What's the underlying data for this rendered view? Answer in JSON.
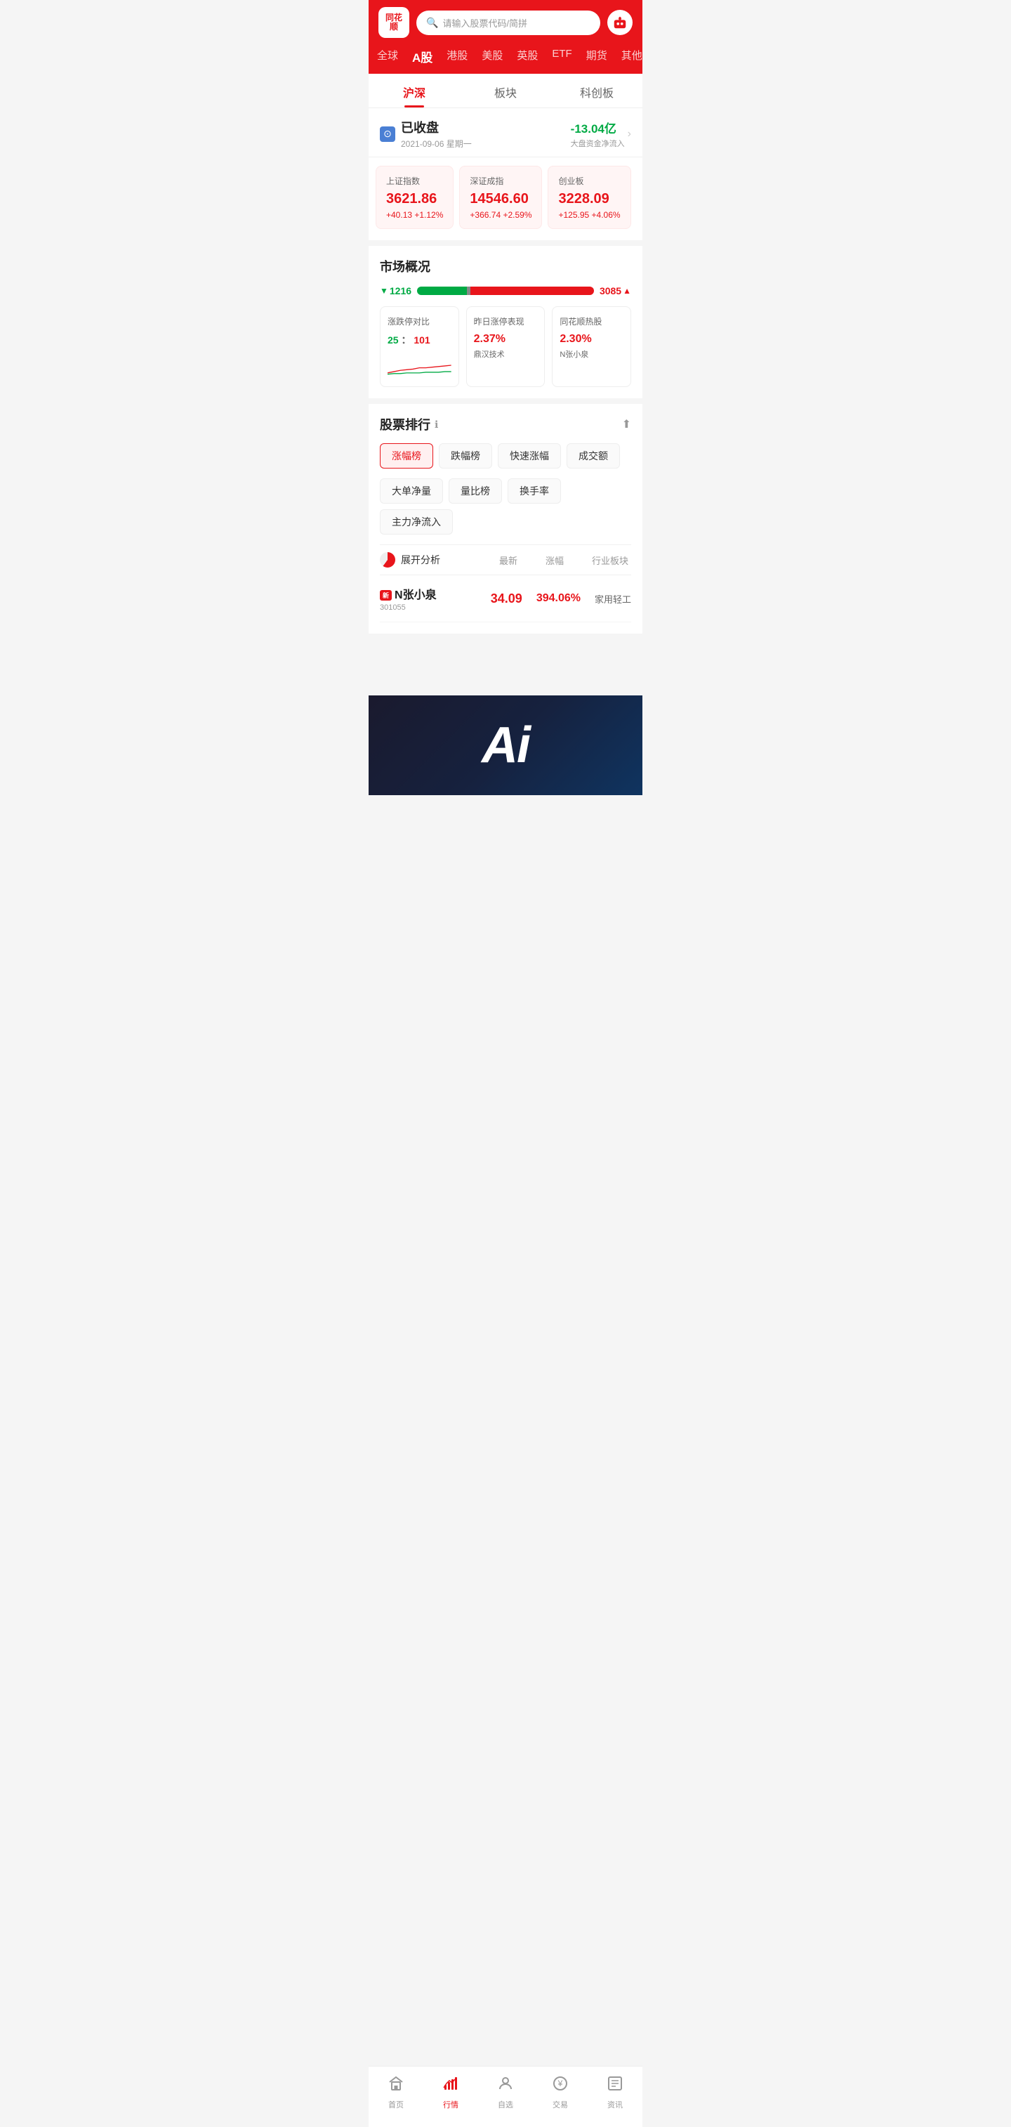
{
  "header": {
    "logo_line1": "同花",
    "logo_line2": "顺",
    "search_placeholder": "请输入股票代码/简拼",
    "avatar_icon": "👤"
  },
  "nav_tabs": [
    {
      "label": "全球",
      "active": false
    },
    {
      "label": "A股",
      "active": true
    },
    {
      "label": "港股",
      "active": false
    },
    {
      "label": "美股",
      "active": false
    },
    {
      "label": "英股",
      "active": false
    },
    {
      "label": "ETF",
      "active": false
    },
    {
      "label": "期货",
      "active": false
    },
    {
      "label": "其他",
      "active": false
    }
  ],
  "sub_tabs": [
    {
      "label": "沪深",
      "active": true
    },
    {
      "label": "板块",
      "active": false
    },
    {
      "label": "科创板",
      "active": false
    }
  ],
  "market_status": {
    "title": "已收盘",
    "date": "2021-09-06 星期一",
    "fund_flow": "-13.04亿",
    "fund_label": "大盘资金净流入"
  },
  "indices": [
    {
      "name": "上证指数",
      "value": "3621.86",
      "change": "+40.13  +1.12%"
    },
    {
      "name": "深证成指",
      "value": "14546.60",
      "change": "+366.74  +2.59%"
    },
    {
      "name": "创业板",
      "value": "3228.09",
      "change": "+125.95  +4.06%"
    }
  ],
  "market_overview": {
    "title": "市场概况",
    "down_count": "1216",
    "up_count": "3085",
    "bar": {
      "green_pct": 28,
      "gray_pct": 2,
      "red_pct": 70
    },
    "stats": [
      {
        "title": "涨跌停对比",
        "ratio_green": "25",
        "ratio_red": "101",
        "has_chart": true
      },
      {
        "title": "昨日涨停表现",
        "value": "2.37%",
        "sub": "鼎汉技术"
      },
      {
        "title": "同花顺热股",
        "value": "2.30%",
        "sub": "N张小泉"
      }
    ]
  },
  "stock_ranking": {
    "title": "股票排行",
    "info_icon": "ℹ",
    "top_icon": "⬆",
    "filters_row1": [
      {
        "label": "涨幅榜",
        "active": true
      },
      {
        "label": "跌幅榜",
        "active": false
      },
      {
        "label": "快速涨幅",
        "active": false
      },
      {
        "label": "成交额",
        "active": false
      }
    ],
    "filters_row2": [
      {
        "label": "大单净量",
        "active": false
      },
      {
        "label": "量比榜",
        "active": false
      },
      {
        "label": "换手率",
        "active": false
      },
      {
        "label": "主力净流入",
        "active": false
      }
    ],
    "col_headers": {
      "price": "最新",
      "change": "涨幅",
      "sector": "行业板块"
    },
    "analysis_label": "展开分析",
    "stocks": [
      {
        "name": "N张小泉",
        "badge": "新",
        "code": "301055",
        "price": "34.09",
        "pct": "394.06%",
        "sector": "家用轻工"
      }
    ]
  },
  "bottom_nav": [
    {
      "label": "首页",
      "icon": "📊",
      "active": false
    },
    {
      "label": "行情",
      "icon": "📈",
      "active": true
    },
    {
      "label": "自选",
      "icon": "👤",
      "active": false
    },
    {
      "label": "交易",
      "icon": "💴",
      "active": false
    },
    {
      "label": "资讯",
      "icon": "📋",
      "active": false
    }
  ],
  "ai_section": {
    "text": "Ai"
  }
}
